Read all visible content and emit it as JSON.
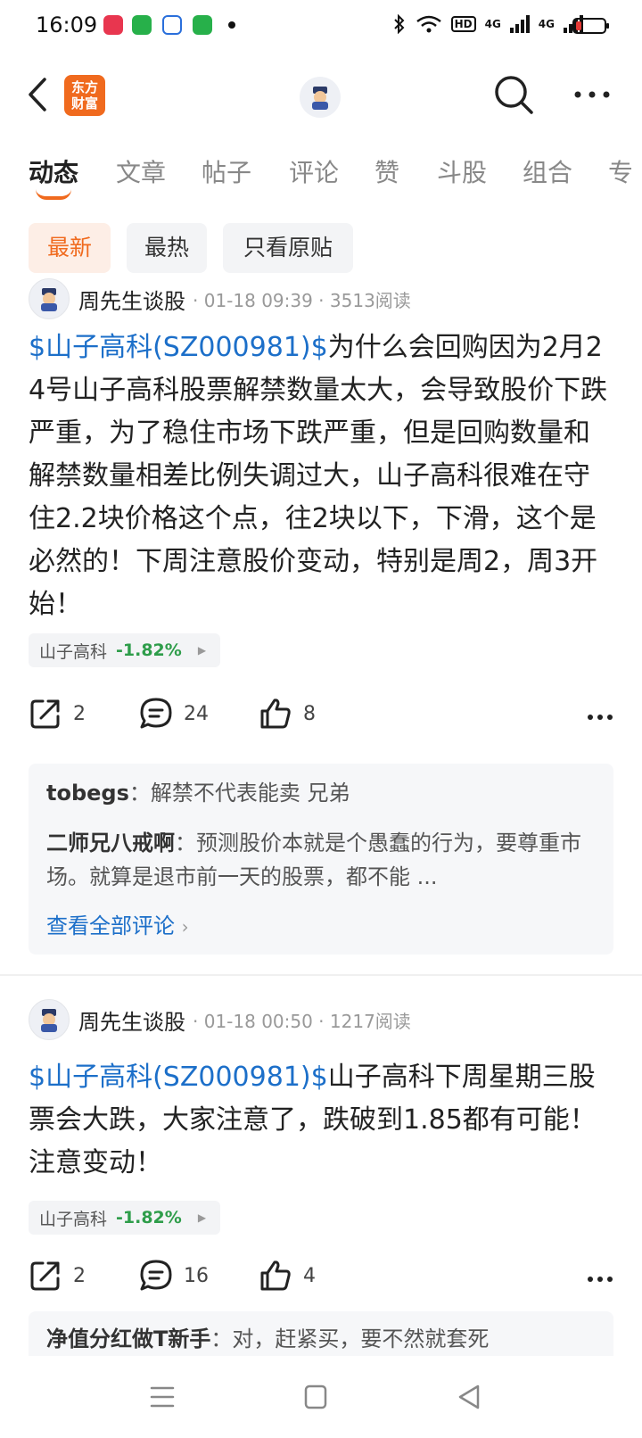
{
  "status_bar": {
    "time": "16:09",
    "signal_1": "4G",
    "signal_2": "4G",
    "hd_label": "HD"
  },
  "header": {
    "brand_line1": "东方",
    "brand_line2": "财富"
  },
  "tabs": [
    {
      "label": "动态"
    },
    {
      "label": "文章"
    },
    {
      "label": "帖子"
    },
    {
      "label": "评论"
    },
    {
      "label": "赞"
    },
    {
      "label": "斗股"
    },
    {
      "label": "组合"
    },
    {
      "label": "专"
    }
  ],
  "filters": {
    "latest": "最新",
    "hottest": "最热",
    "original_only": "只看原贴"
  },
  "posts": [
    {
      "author": "周先生谈股",
      "meta": "· 01-18 09:39 · 3513阅读",
      "stock_link": "$山子高科(SZ000981)$",
      "text": "为什么会回购因为2月24号山子高科股票解禁数量太大，会导致股价下跌严重，为了稳住市场下跌严重，但是回购数量和解禁数量相差比例失调过大，山子高科很难在守住2.2块价格这个点，往2块以下，下滑，这个是必然的！下周注意股价变动，特别是周2，周3开始！",
      "stock_tag": {
        "name": "山子高科",
        "change": "-1.82%"
      },
      "shares": "2",
      "comments": "24",
      "likes": "8",
      "comment_preview": [
        {
          "user": "tobegs",
          "text": "解禁不代表能卖 兄弟"
        },
        {
          "user": "二师兄八戒啊",
          "text": "预测股价本就是个愚蠢的行为，要尊重市场。就算是退市前一天的股票，都不能 ..."
        }
      ],
      "see_all": "查看全部评论"
    },
    {
      "author": "周先生谈股",
      "meta": "· 01-18 00:50 · 1217阅读",
      "stock_link": "$山子高科(SZ000981)$",
      "text": "山子高科下周星期三股票会大跌，大家注意了，跌破到1.85都有可能！注意变动！",
      "stock_tag": {
        "name": "山子高科",
        "change": "-1.82%"
      },
      "shares": "2",
      "comments": "16",
      "likes": "4",
      "comment_preview": [
        {
          "user": "净值分红做T新手",
          "text": "对，赶紧买，要不然就套死"
        }
      ]
    }
  ],
  "colors": {
    "accent": "#f06a1e",
    "link": "#1c6fc9",
    "stock_change": "#2e9d4a"
  }
}
